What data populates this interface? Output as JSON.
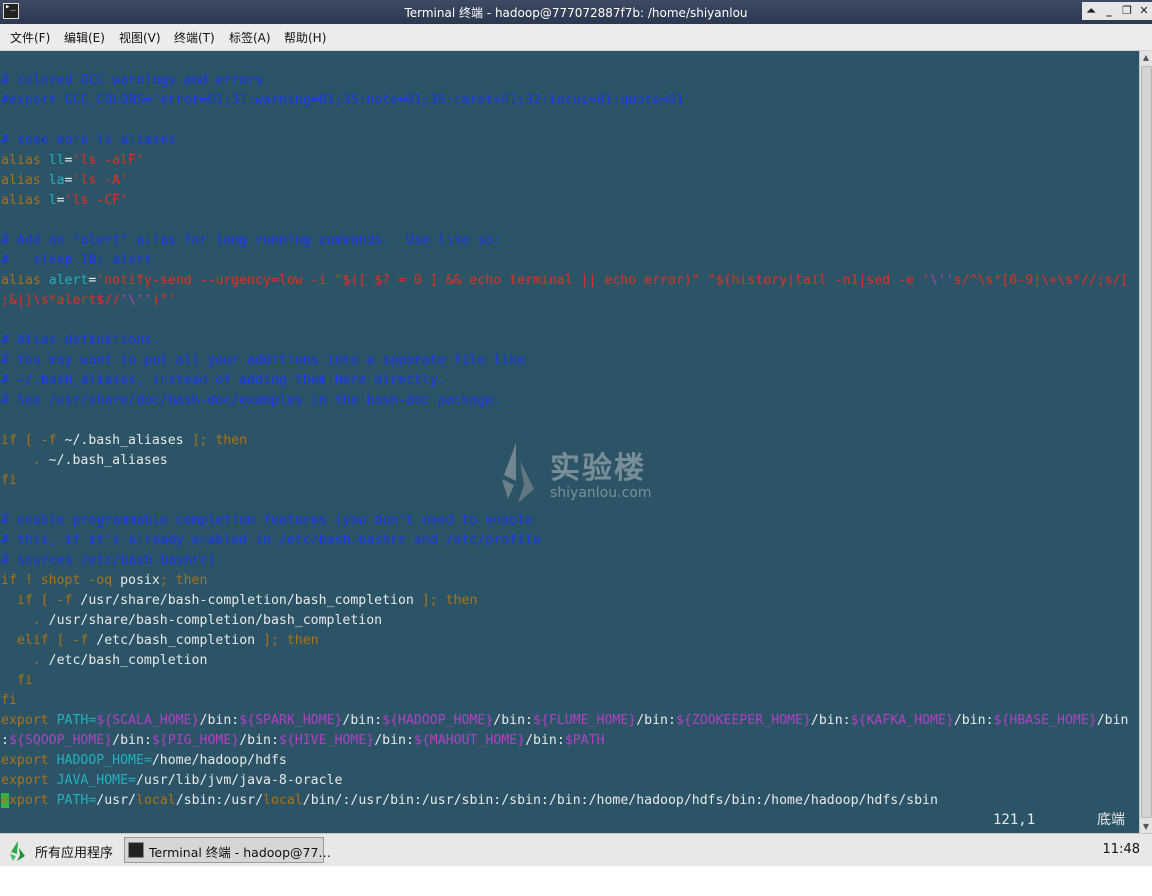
{
  "window": {
    "title": "Terminal 终端 - hadoop@777072887f7b: /home/shiyanlou",
    "controls": [
      "⏶",
      "_",
      "❐",
      "✕"
    ]
  },
  "menu": [
    "文件(F)",
    "编辑(E)",
    "视图(V)",
    "终端(T)",
    "标签(A)",
    "帮助(H)"
  ],
  "colors": {
    "terminal_bg": "#2b5466",
    "comment": "#1a35ee",
    "keyword": "#b07010",
    "string": "#e62e1e",
    "identifier": "#22b0c0",
    "variable": "#b13fc6",
    "text": "#e8e8e8",
    "cursor": "#2fb84a"
  },
  "lines": [
    [],
    [
      [
        "c",
        "# colored GCC warnings and errors"
      ]
    ],
    [
      [
        "c",
        "#export GCC_COLORS='error=01;31:warning=01;35:note=01;36:caret=01;32:locus=01:quote=01'"
      ]
    ],
    [],
    [
      [
        "c",
        "# some more ls aliases"
      ]
    ],
    [
      [
        "k",
        "alias "
      ],
      [
        "t",
        "ll"
      ],
      [
        "w",
        "="
      ],
      [
        "s",
        "'ls -alF'"
      ]
    ],
    [
      [
        "k",
        "alias "
      ],
      [
        "t",
        "la"
      ],
      [
        "w",
        "="
      ],
      [
        "s",
        "'ls -A'"
      ]
    ],
    [
      [
        "k",
        "alias "
      ],
      [
        "t",
        "l"
      ],
      [
        "w",
        "="
      ],
      [
        "s",
        "'ls -CF'"
      ]
    ],
    [],
    [
      [
        "c",
        "# Add an \"alert\" alias for long running commands.  Use like so:"
      ]
    ],
    [
      [
        "c",
        "#   sleep 10; alert"
      ]
    ],
    [
      [
        "k",
        "alias "
      ],
      [
        "t",
        "alert"
      ],
      [
        "w",
        "="
      ],
      [
        "s",
        "'notify-send --urgency=low -i \"$([ $? = 0 ] && echo terminal || echo error)\" \"$(history|tail -n1|sed -e '"
      ],
      [
        "v",
        "\\''"
      ],
      [
        "s",
        "s/^\\s*[0-9]\\+\\s*//;s/["
      ]
    ],
    [
      [
        "s",
        ";&|]\\s*alert$//"
      ],
      [
        "v",
        "'\\''"
      ],
      [
        "s",
        ")\"'"
      ]
    ],
    [],
    [
      [
        "c",
        "# Alias definitions."
      ]
    ],
    [
      [
        "c",
        "# You may want to put all your additions into a separate file like"
      ]
    ],
    [
      [
        "c",
        "# ~/.bash_aliases, instead of adding them here directly."
      ]
    ],
    [
      [
        "c",
        "# See /usr/share/doc/bash-doc/examples in the bash-doc package."
      ]
    ],
    [],
    [
      [
        "k",
        "if [ -f "
      ],
      [
        "w",
        "~/.bash_aliases"
      ],
      [
        "k",
        " ]; then"
      ]
    ],
    [
      [
        "k",
        "    . "
      ],
      [
        "w",
        "~/.bash_aliases"
      ]
    ],
    [
      [
        "k",
        "fi"
      ]
    ],
    [],
    [
      [
        "c",
        "# enable programmable completion features (you don't need to enable"
      ]
    ],
    [
      [
        "c",
        "# this, if it's already enabled in /etc/bash.bashrc and /etc/profile"
      ]
    ],
    [
      [
        "c",
        "# sources /etc/bash.bashrc)."
      ]
    ],
    [
      [
        "k",
        "if ! shopt -oq "
      ],
      [
        "w",
        "posix"
      ],
      [
        "k",
        "; then"
      ]
    ],
    [
      [
        "k",
        "  if [ -f "
      ],
      [
        "w",
        "/usr/share/bash-completion/bash_completion"
      ],
      [
        "k",
        " ]; then"
      ]
    ],
    [
      [
        "k",
        "    . "
      ],
      [
        "w",
        "/usr/share/bash-completion/bash_completion"
      ]
    ],
    [
      [
        "k",
        "  elif [ -f "
      ],
      [
        "w",
        "/etc/bash_completion"
      ],
      [
        "k",
        " ]; then"
      ]
    ],
    [
      [
        "k",
        "    . "
      ],
      [
        "w",
        "/etc/bash_completion"
      ]
    ],
    [
      [
        "k",
        "  fi"
      ]
    ],
    [
      [
        "k",
        "fi"
      ]
    ],
    [
      [
        "k",
        "export "
      ],
      [
        "t",
        "PATH="
      ],
      [
        "v",
        "${SCALA_HOME}"
      ],
      [
        "w",
        "/bin:"
      ],
      [
        "v",
        "${SPARK_HOME}"
      ],
      [
        "w",
        "/bin:"
      ],
      [
        "v",
        "${HADOOP_HOME}"
      ],
      [
        "w",
        "/bin:"
      ],
      [
        "v",
        "${FLUME_HOME}"
      ],
      [
        "w",
        "/bin:"
      ],
      [
        "v",
        "${ZOOKEEPER_HOME}"
      ],
      [
        "w",
        "/bin:"
      ],
      [
        "v",
        "${KAFKA_HOME}"
      ],
      [
        "w",
        "/bin:"
      ],
      [
        "v",
        "${HBASE_HOME}"
      ],
      [
        "w",
        "/bin"
      ]
    ],
    [
      [
        "w",
        ":"
      ],
      [
        "v",
        "${SQOOP_HOME}"
      ],
      [
        "w",
        "/bin:"
      ],
      [
        "v",
        "${PIG_HOME}"
      ],
      [
        "w",
        "/bin:"
      ],
      [
        "v",
        "${HIVE_HOME}"
      ],
      [
        "w",
        "/bin:"
      ],
      [
        "v",
        "${MAHOUT_HOME}"
      ],
      [
        "w",
        "/bin:"
      ],
      [
        "v",
        "$PATH"
      ]
    ],
    [
      [
        "k",
        "export "
      ],
      [
        "t",
        "HADOOP_HOME="
      ],
      [
        "w",
        "/home/hadoop/hdfs"
      ]
    ],
    [
      [
        "k",
        "export "
      ],
      [
        "t",
        "JAVA_HOME="
      ],
      [
        "w",
        "/usr/lib/jvm/java-8-oracle"
      ]
    ],
    [
      [
        "cursor",
        "e"
      ],
      [
        "k",
        "xport "
      ],
      [
        "t",
        "PATH="
      ],
      [
        "w",
        "/usr/"
      ],
      [
        "k",
        "local"
      ],
      [
        "w",
        "/sbin:/usr/"
      ],
      [
        "k",
        "local"
      ],
      [
        "w",
        "/bin/:/usr/bin:/usr/sbin:/sbin:/bin:/home/hadoop/hdfs/bin:/home/hadoop/hdfs/sbin"
      ]
    ]
  ],
  "status": {
    "position": "121,1",
    "location": "底端"
  },
  "watermark": {
    "cn": "实验楼",
    "en": "shiyanlou.com"
  },
  "taskbar": {
    "start_label": "所有应用程序",
    "task_label": "Terminal 终端 - hadoop@77…",
    "clock": "11:48"
  }
}
